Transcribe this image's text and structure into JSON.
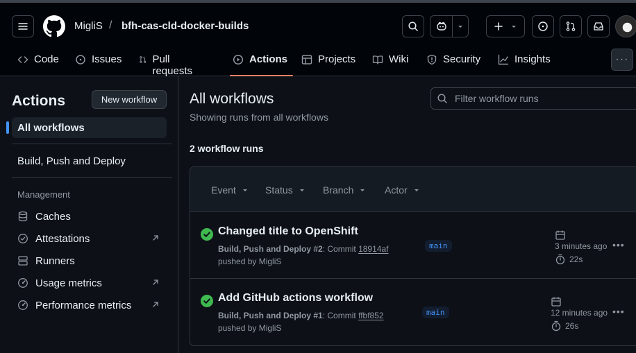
{
  "header": {
    "owner": "MigliS",
    "separator": "/",
    "repo": "bfh-cas-cld-docker-builds"
  },
  "nav": {
    "tabs": [
      {
        "label": "Code",
        "icon": "code-icon"
      },
      {
        "label": "Issues",
        "icon": "issue-icon"
      },
      {
        "label": "Pull requests",
        "icon": "pull-request-icon"
      },
      {
        "label": "Actions",
        "icon": "play-icon",
        "selected": true
      },
      {
        "label": "Projects",
        "icon": "table-icon"
      },
      {
        "label": "Wiki",
        "icon": "book-icon"
      },
      {
        "label": "Security",
        "icon": "shield-icon"
      },
      {
        "label": "Insights",
        "icon": "graph-icon"
      }
    ],
    "more": "···"
  },
  "sidebar": {
    "title": "Actions",
    "new_workflow": "New workflow",
    "all_workflows": "All workflows",
    "workflows": [
      "Build, Push and Deploy"
    ],
    "management_label": "Management",
    "management": [
      {
        "label": "Caches",
        "icon": "database-icon",
        "external": false
      },
      {
        "label": "Attestations",
        "icon": "verified-icon",
        "external": true
      },
      {
        "label": "Runners",
        "icon": "server-icon",
        "external": false
      },
      {
        "label": "Usage metrics",
        "icon": "meter-icon",
        "external": true
      },
      {
        "label": "Performance metrics",
        "icon": "meter-icon",
        "external": true
      }
    ]
  },
  "main": {
    "title": "All workflows",
    "subtitle": "Showing runs from all workflows",
    "filter_placeholder": "Filter workflow runs",
    "runs_count": "2 workflow runs",
    "filters": [
      "Event",
      "Status",
      "Branch",
      "Actor"
    ],
    "runs": [
      {
        "title": "Changed title to OpenShift",
        "workflow": "Build, Push and Deploy",
        "run_number": "#2",
        "commit_label": "Commit",
        "sha": "18914af",
        "pushed_by": "pushed by MigliS",
        "branch": "main",
        "time": "3 minutes ago",
        "duration": "22s",
        "status": "success"
      },
      {
        "title": "Add GitHub actions workflow",
        "workflow": "Build, Push and Deploy",
        "run_number": "#1",
        "commit_label": "Commit",
        "sha": "ffbf852",
        "pushed_by": "pushed by MigliS",
        "branch": "main",
        "time": "12 minutes ago",
        "duration": "26s",
        "status": "success"
      }
    ]
  },
  "colors": {
    "accent": "#f78166",
    "success": "#3fb950",
    "link": "#4493f8"
  }
}
